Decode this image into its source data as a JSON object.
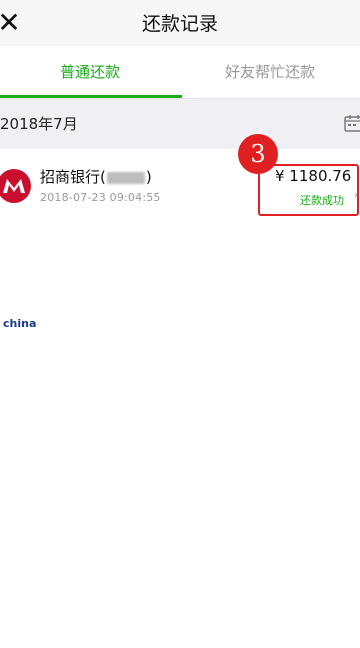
{
  "header": {
    "close_icon": "close-icon",
    "title": "还款记录"
  },
  "tabs": [
    {
      "label": "普通还款",
      "active": true
    },
    {
      "label": "好友帮忙还款",
      "active": false
    }
  ],
  "month_group": {
    "label": "2018年7月",
    "icon": "calendar-icon"
  },
  "records": [
    {
      "bank_name_prefix": "招商银行(",
      "bank_name_suffix": ")",
      "timestamp": "2018-07-23 09:04:55",
      "amount": "¥ 1180.76",
      "status": "还款成功",
      "logo": "bank-logo-icon"
    }
  ],
  "annotation": {
    "badge_number": "3"
  },
  "watermark": "china",
  "colors": {
    "accent_green": "#1aad19",
    "highlight_red": "#e02020",
    "brand_red": "#c8102e"
  }
}
